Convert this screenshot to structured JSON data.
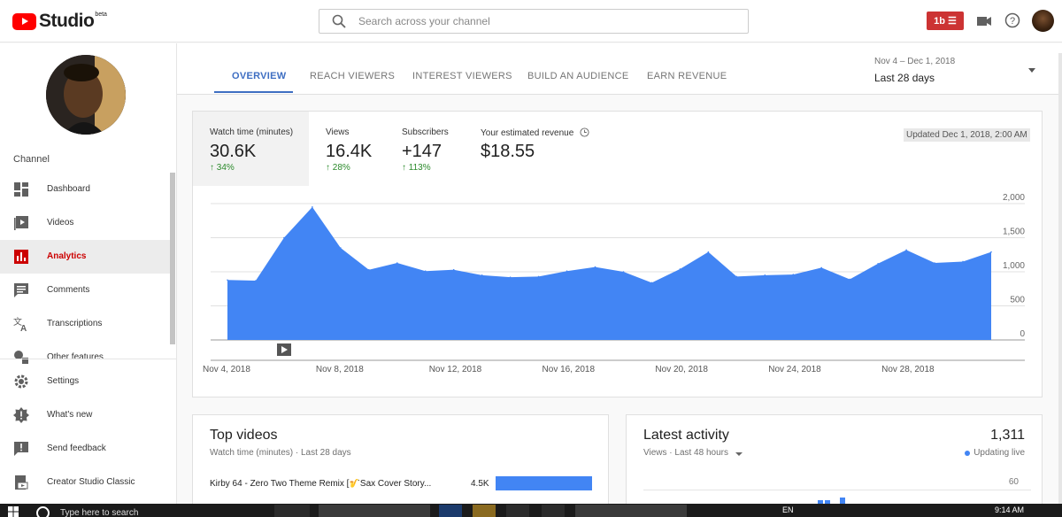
{
  "topbar": {
    "logo_text": "Studio",
    "logo_badge": "beta",
    "search_placeholder": "Search across your channel",
    "create_label": "1b"
  },
  "sidebar": {
    "section_label": "Channel",
    "items": [
      {
        "label": "Dashboard",
        "icon": "dashboard-icon"
      },
      {
        "label": "Videos",
        "icon": "videos-icon"
      },
      {
        "label": "Analytics",
        "icon": "analytics-icon",
        "active": true
      },
      {
        "label": "Comments",
        "icon": "comments-icon"
      },
      {
        "label": "Transcriptions",
        "icon": "translate-icon"
      },
      {
        "label": "Other features",
        "icon": "other-features-icon"
      },
      {
        "label": "Settings",
        "icon": "gear-icon"
      },
      {
        "label": "What's new",
        "icon": "whats-new-icon"
      },
      {
        "label": "Send feedback",
        "icon": "feedback-icon"
      },
      {
        "label": "Creator Studio Classic",
        "icon": "classic-icon"
      }
    ]
  },
  "tabs": [
    {
      "label": "OVERVIEW",
      "active": true
    },
    {
      "label": "REACH VIEWERS"
    },
    {
      "label": "INTEREST VIEWERS"
    },
    {
      "label": "BUILD AN AUDIENCE"
    },
    {
      "label": "EARN REVENUE"
    }
  ],
  "date_range": {
    "range": "Nov 4 – Dec 1, 2018",
    "label": "Last 28 days"
  },
  "metrics": [
    {
      "label": "Watch time (minutes)",
      "value": "30.6K",
      "delta": "34%",
      "active": true
    },
    {
      "label": "Views",
      "value": "16.4K",
      "delta": "28%"
    },
    {
      "label": "Subscribers",
      "value": "+147",
      "delta": "113%"
    },
    {
      "label": "Your estimated revenue",
      "value": "$18.55",
      "delta": ""
    }
  ],
  "updated_text": "Updated Dec 1, 2018, 2:00 AM",
  "colors": {
    "accent": "#3e6ec2",
    "area": "#4285f4",
    "positive": "#2b8a2b",
    "youtube_red": "#ff0000"
  },
  "chart_data": {
    "type": "area",
    "x": [
      "Nov 4",
      "Nov 5",
      "Nov 6",
      "Nov 7",
      "Nov 8",
      "Nov 9",
      "Nov 10",
      "Nov 11",
      "Nov 12",
      "Nov 13",
      "Nov 14",
      "Nov 15",
      "Nov 16",
      "Nov 17",
      "Nov 18",
      "Nov 19",
      "Nov 20",
      "Nov 21",
      "Nov 22",
      "Nov 23",
      "Nov 24",
      "Nov 25",
      "Nov 26",
      "Nov 27",
      "Nov 28",
      "Nov 29",
      "Nov 30",
      "Dec 1"
    ],
    "values": [
      880,
      870,
      1500,
      1950,
      1350,
      1030,
      1130,
      1010,
      1030,
      950,
      920,
      930,
      1010,
      1070,
      1000,
      840,
      1040,
      1290,
      930,
      950,
      960,
      1060,
      890,
      1120,
      1320,
      1130,
      1150,
      1290
    ],
    "x_tick_labels": [
      "Nov 4, 2018",
      "Nov 8, 2018",
      "Nov 12, 2018",
      "Nov 16, 2018",
      "Nov 20, 2018",
      "Nov 24, 2018",
      "Nov 28, 2018"
    ],
    "y_ticks": [
      "2,000",
      "1,500",
      "1,000",
      "500",
      "0"
    ],
    "ylim": [
      0,
      2000
    ],
    "grid": true
  },
  "top_videos": {
    "title": "Top videos",
    "subtitle": "Watch time (minutes) · Last 28 days",
    "rows": [
      {
        "title": "Kirby 64 - Zero Two Theme Remix [🎷Sax Cover Story...",
        "value": "4.5K",
        "fraction": 1.0
      }
    ]
  },
  "latest_activity": {
    "title": "Latest activity",
    "subtitle": "Views · Last 48 hours",
    "count": "1,311",
    "status": "Updating live",
    "axis_top": "60"
  },
  "taskbar": {
    "search_text": "Type here to search",
    "lang": "EN",
    "time": "9:14 AM"
  }
}
